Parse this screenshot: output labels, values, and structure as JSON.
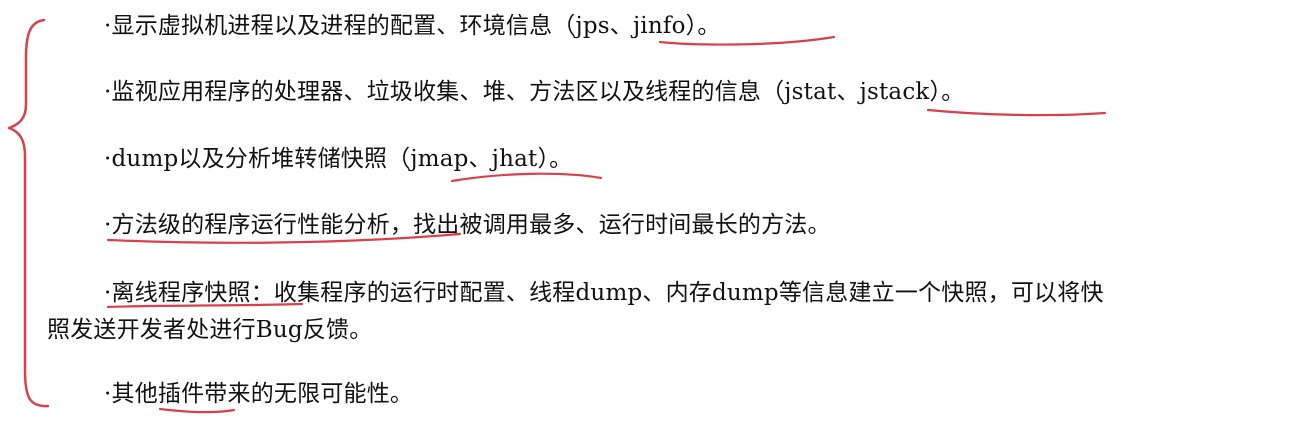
{
  "annotation_color": "#d9414a",
  "text_color": "#111111",
  "icons": {
    "brace": "curly-brace-icon",
    "underline": "underline-stroke-icon"
  },
  "items": [
    "·显示虚拟机进程以及进程的配置、环境信息（jps、jinfo）。",
    "·监视应用程序的处理器、垃圾收集、堆、方法区以及线程的信息（jstat、jstack）。",
    "·dump以及分析堆转储快照（jmap、jhat）。",
    "·方法级的程序运行性能分析，找出被调用最多、运行时间最长的方法。",
    "·离线程序快照：收集程序的运行时配置、线程dump、内存dump等信息建立一个快照，可以将快",
    "照发送开发者处进行Bug反馈。",
    "·其他插件带来的无限可能性。"
  ]
}
